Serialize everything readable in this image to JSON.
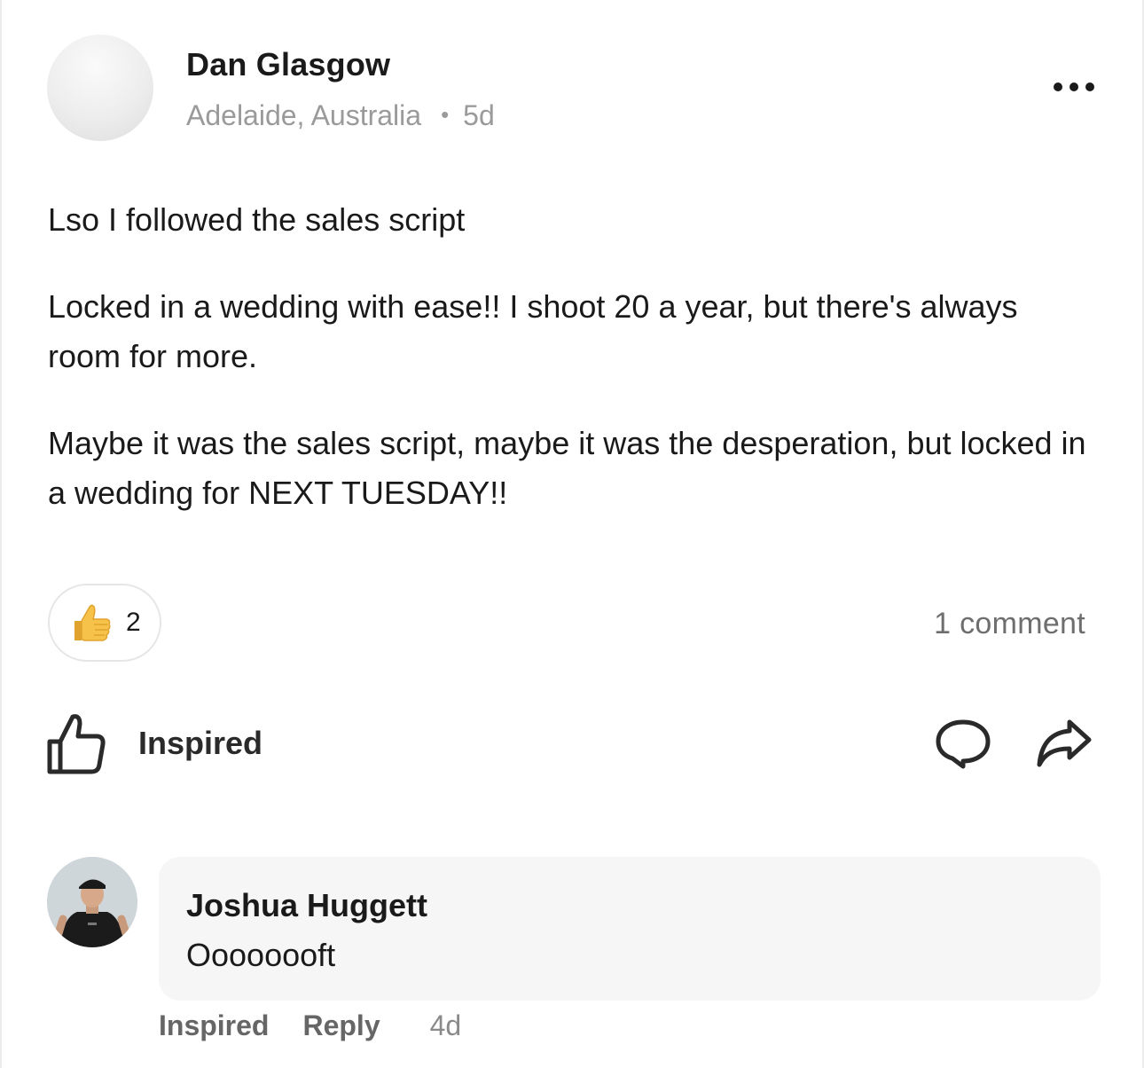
{
  "post": {
    "author": "Dan Glasgow",
    "location": "Adelaide, Australia",
    "separator": "•",
    "age": "5d",
    "paragraphs": [
      "Lso I followed the sales script",
      "Locked in a wedding with ease!! I shoot 20 a year, but there's always room for more.",
      "Maybe it was the sales script, maybe it was the desperation, but locked in a wedding for NEXT TUESDAY!!"
    ],
    "reaction": {
      "icon": "thumbs-up-emoji",
      "count": "2"
    },
    "comment_count": "1 comment",
    "actions": {
      "like_label": "Inspired",
      "like_icon": "thumbs-up-outline-icon",
      "comment_icon": "chat-bubble-icon",
      "share_icon": "share-arrow-icon",
      "more_icon": "more-horizontal-icon"
    }
  },
  "comment": {
    "author": "Joshua Huggett",
    "text": "Oooooooft",
    "inspired_label": "Inspired",
    "reply_label": "Reply",
    "age": "4d"
  },
  "colors": {
    "text": "#1a1a1a",
    "muted": "#9a9a9a",
    "bubble": "#f6f6f6",
    "emoji": "#f7c24a"
  }
}
